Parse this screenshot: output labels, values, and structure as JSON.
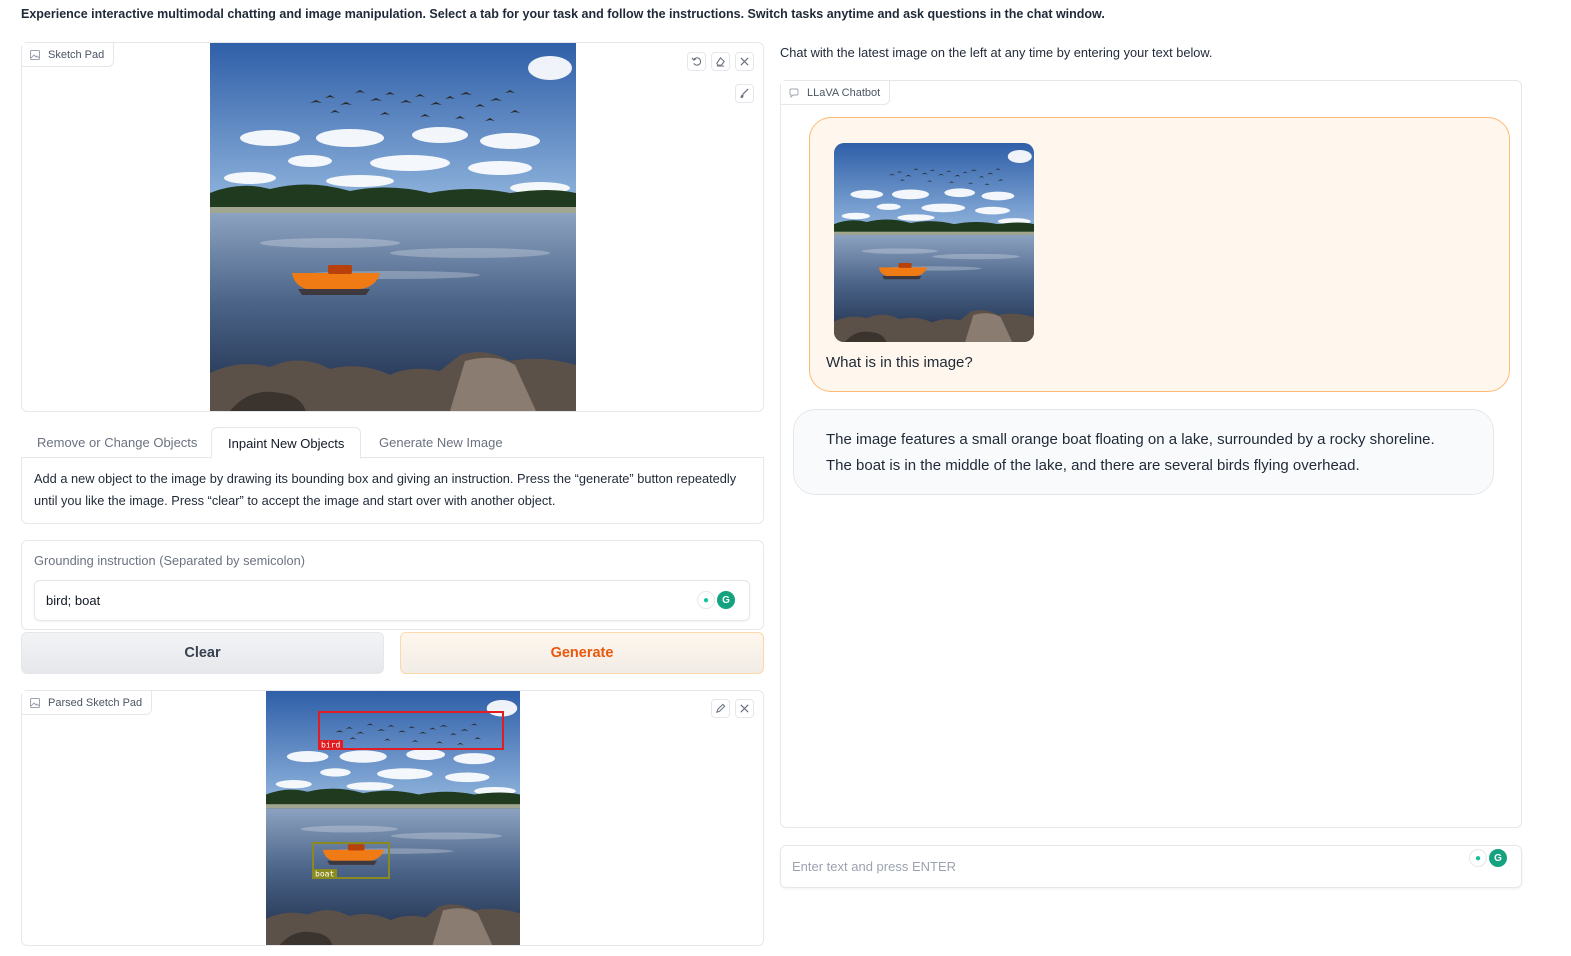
{
  "header": {
    "description": "Experience interactive multimodal chatting and image manipulation. Select a tab for your task and follow the instructions. Switch tasks anytime and ask questions in the chat window."
  },
  "sketch_pad": {
    "label": "Sketch Pad",
    "icons": [
      "undo-icon",
      "eraser-icon",
      "close-icon",
      "brush-icon"
    ]
  },
  "tabs": [
    {
      "label": "Remove or Change Objects",
      "active": false
    },
    {
      "label": "Inpaint New Objects",
      "active": true
    },
    {
      "label": "Generate New Image",
      "active": false
    }
  ],
  "instructions": {
    "text": "Add a new object to the image by drawing its bounding box and giving an instruction. Press the “generate” button repeatedly until you like the image. Press “clear” to accept the image and start over with another object."
  },
  "grounding": {
    "label": "Grounding instruction (Separated by semicolon)",
    "value": "bird; boat"
  },
  "buttons": {
    "clear": "Clear",
    "generate": "Generate"
  },
  "parsed_sketch_pad": {
    "label": "Parsed Sketch Pad",
    "boxes": [
      {
        "label": "bird",
        "color": "#e11d24"
      },
      {
        "label": "boat",
        "color": "#8a8a1f"
      }
    ]
  },
  "chat": {
    "caption": "Chat with the latest image on the left at any time by entering your text below.",
    "label": "LLaVA Chatbot",
    "user_message": "What is in this image?",
    "bot_message": "The image features a small orange boat floating on a lake, surrounded by a rocky shoreline. The boat is in the middle of the lake, and there are several birds flying overhead.",
    "input_placeholder": "Enter text and press ENTER"
  },
  "colors": {
    "accent": "#ea580c",
    "user_bubble": "#fff7ed",
    "user_border": "#fdba74",
    "grammarly_green": "#15c39a"
  }
}
